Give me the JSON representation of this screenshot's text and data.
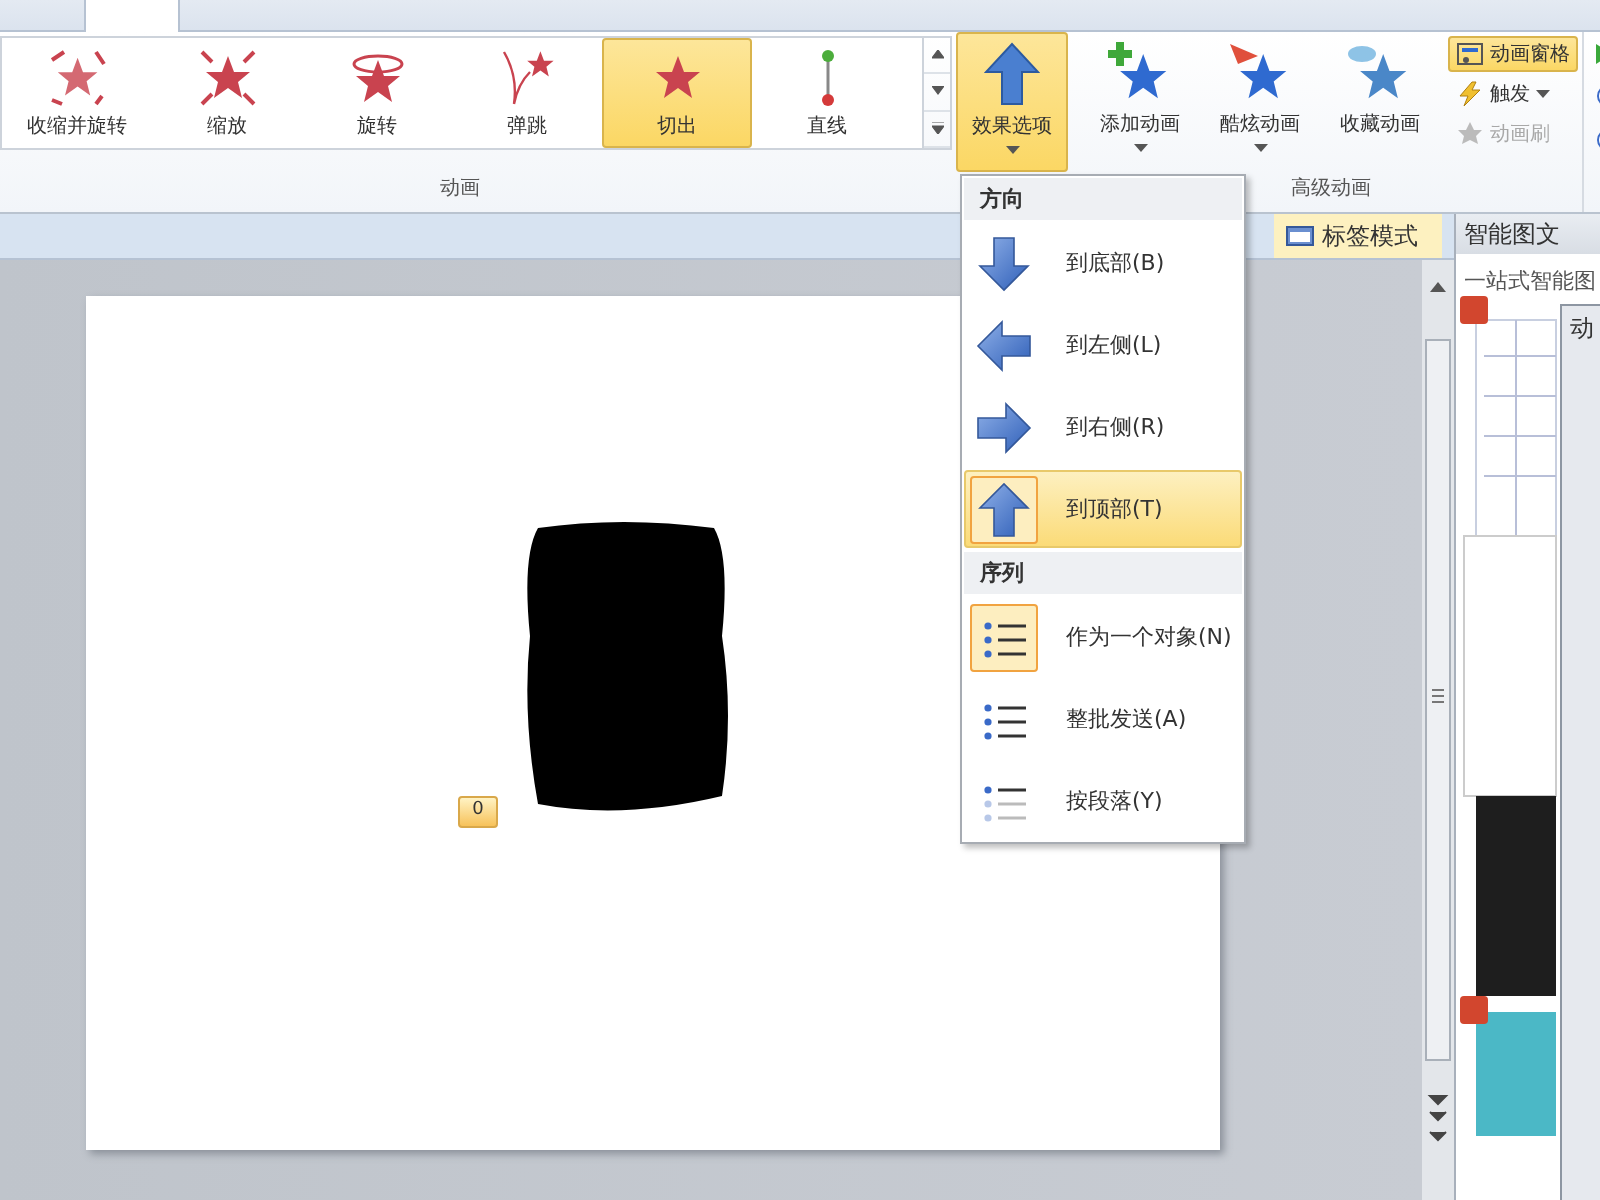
{
  "ribbon": {
    "gallery": [
      {
        "label": "收缩并旋转",
        "kind": "shrink",
        "selected": false
      },
      {
        "label": "缩放",
        "kind": "zoom",
        "selected": false
      },
      {
        "label": "旋转",
        "kind": "spin",
        "selected": false
      },
      {
        "label": "弹跳",
        "kind": "bounce",
        "selected": false
      },
      {
        "label": "切出",
        "kind": "star",
        "selected": true
      },
      {
        "label": "直线",
        "kind": "line",
        "selected": false
      }
    ],
    "group_label": "动画",
    "effect_options": {
      "label": "效果选项",
      "open": true
    },
    "advanced": [
      {
        "label": "添加动画",
        "kind": "add",
        "dropdown": true
      },
      {
        "label": "酷炫动画",
        "kind": "plane",
        "dropdown": true
      },
      {
        "label": "收藏动画",
        "kind": "cloud",
        "dropdown": false
      }
    ],
    "advanced_small": [
      {
        "label": "动画窗格",
        "kind": "pane",
        "on": true,
        "disabled": false,
        "dropdown": false
      },
      {
        "label": "触发",
        "kind": "bolt",
        "on": false,
        "disabled": false,
        "dropdown": true
      },
      {
        "label": "动画刷",
        "kind": "brush",
        "on": false,
        "disabled": true,
        "dropdown": false
      }
    ],
    "advanced_group_label": "高级动画"
  },
  "view_bar": {
    "tag_mode": {
      "label": "标签模式",
      "on": true
    }
  },
  "slide": {
    "animation_badge": "0"
  },
  "side_pane": {
    "title": "智能图文",
    "subtitle": "一站式智能图",
    "dialog_title": "动"
  },
  "dropdown": {
    "sections": [
      {
        "heading": "方向",
        "items": [
          {
            "label": "到底部(B)",
            "kind": "down",
            "selected": false,
            "hovered": false
          },
          {
            "label": "到左侧(L)",
            "kind": "left",
            "selected": false,
            "hovered": false
          },
          {
            "label": "到右侧(R)",
            "kind": "right",
            "selected": false,
            "hovered": false
          },
          {
            "label": "到顶部(T)",
            "kind": "up",
            "selected": true,
            "hovered": true
          }
        ]
      },
      {
        "heading": "序列",
        "items": [
          {
            "label": "作为一个对象(N)",
            "kind": "one",
            "selected": true,
            "hovered": false
          },
          {
            "label": "整批发送(A)",
            "kind": "all",
            "selected": false,
            "hovered": false
          },
          {
            "label": "按段落(Y)",
            "kind": "para",
            "selected": false,
            "hovered": false
          }
        ]
      }
    ]
  }
}
